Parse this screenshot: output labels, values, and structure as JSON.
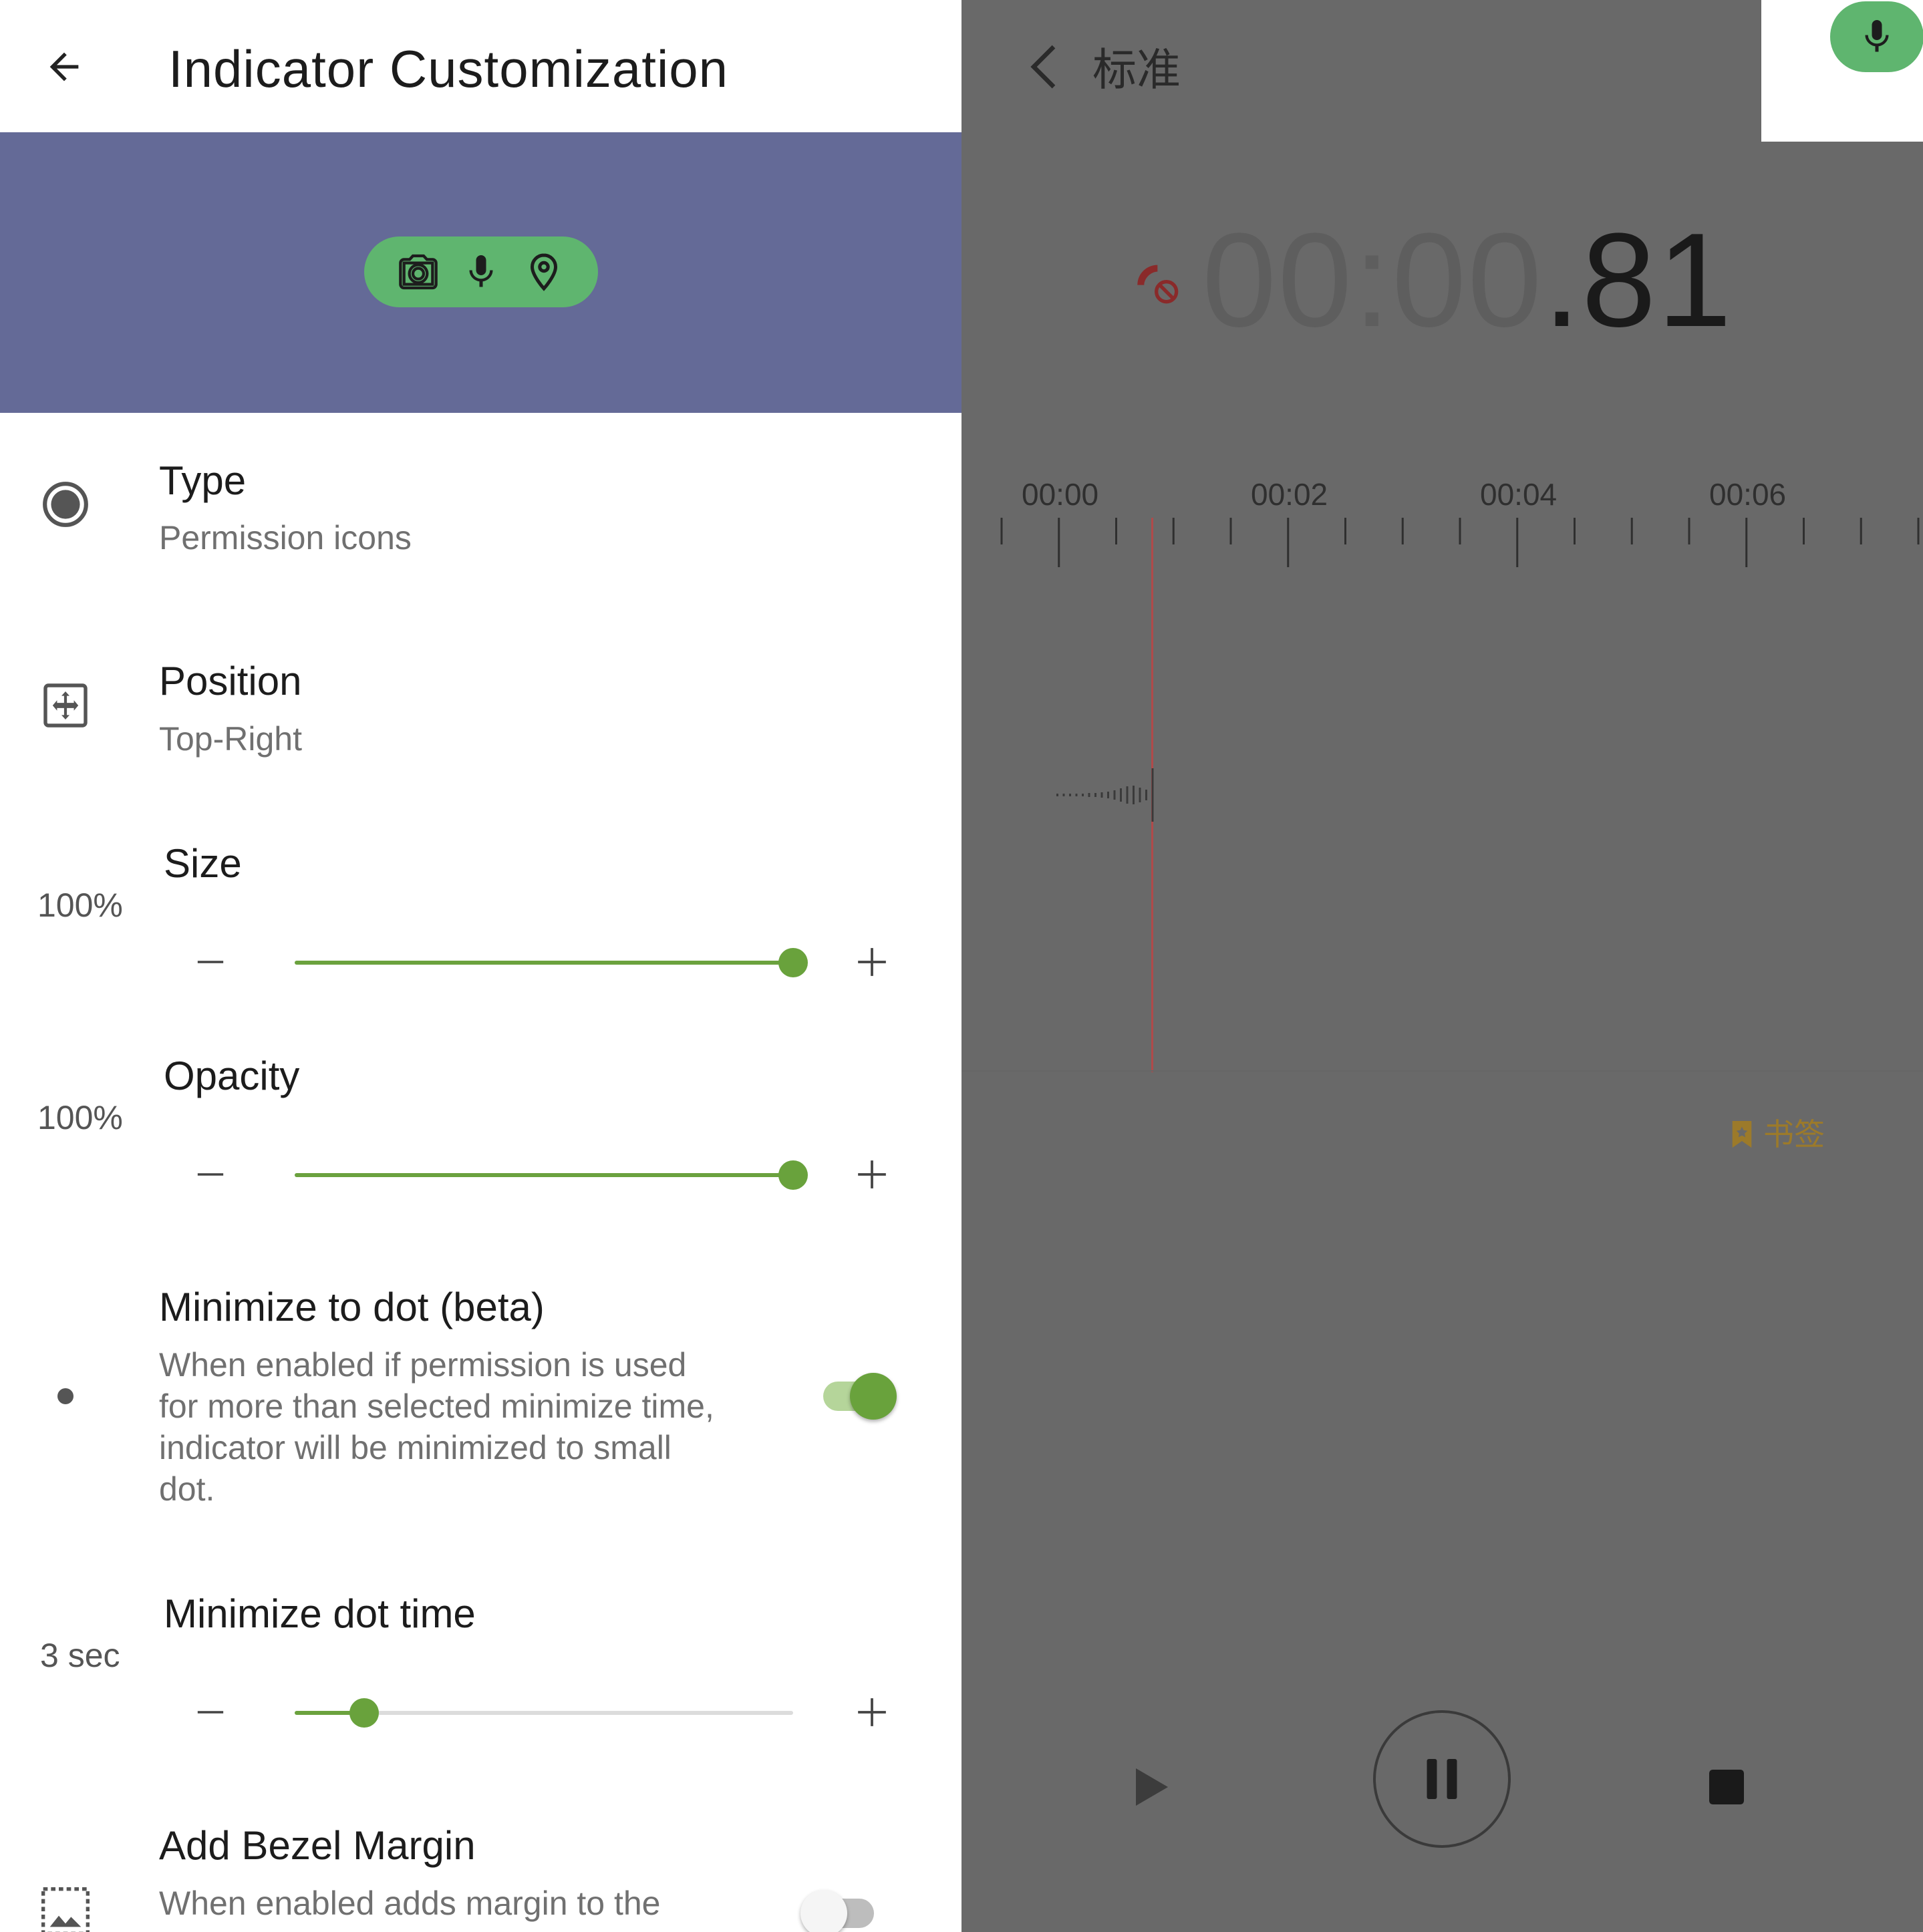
{
  "left": {
    "app_bar": {
      "back_icon": "arrow-left-icon",
      "title": "Indicator Customization"
    },
    "preview": {
      "background_color": "#646a97",
      "pill_color": "#5fb56f",
      "icons": [
        "camera-icon",
        "mic-icon",
        "location-pin-icon"
      ]
    },
    "type": {
      "icon": "radio-filled-icon",
      "title": "Type",
      "subtitle": "Permission icons"
    },
    "position": {
      "icon": "move-arrows-icon",
      "title": "Position",
      "subtitle": "Top-Right"
    },
    "size": {
      "title": "Size",
      "value_label": "100%",
      "value_fraction": 1.0
    },
    "opacity": {
      "title": "Opacity",
      "value_label": "100%",
      "value_fraction": 1.0
    },
    "minimize_dot": {
      "icon": "dot-icon",
      "title": "Minimize to dot (beta)",
      "description_lines": [
        "When enabled if permission is used",
        "for more than selected minimize time,",
        "indicator will be minimized to small",
        "dot."
      ],
      "enabled": true
    },
    "minimize_time": {
      "title": "Minimize dot time",
      "value_label": "3 sec",
      "value_fraction": 0.14
    },
    "bezel_margin": {
      "icon": "image-frame-icon",
      "title": "Add Bezel Margin",
      "description_lines": [
        "When enabled adds margin to the"
      ],
      "enabled": false
    },
    "accent_color": "#6ba23e"
  },
  "right": {
    "header": {
      "back_icon": "chevron-left-icon",
      "title": "标准"
    },
    "mic_indicator_icon": "mic-icon",
    "timer": {
      "dim_part": "00:00",
      "bright_part": ".81"
    },
    "call_status_icon": "call-blocked-icon",
    "timeline_labels": [
      "00:00",
      "00:02",
      "00:04",
      "00:06"
    ],
    "bookmark": {
      "icon": "bookmark-icon",
      "label": "书签"
    },
    "controls": {
      "play_icon": "play-icon",
      "pause_icon": "pause-icon",
      "stop_icon": "stop-icon"
    }
  }
}
